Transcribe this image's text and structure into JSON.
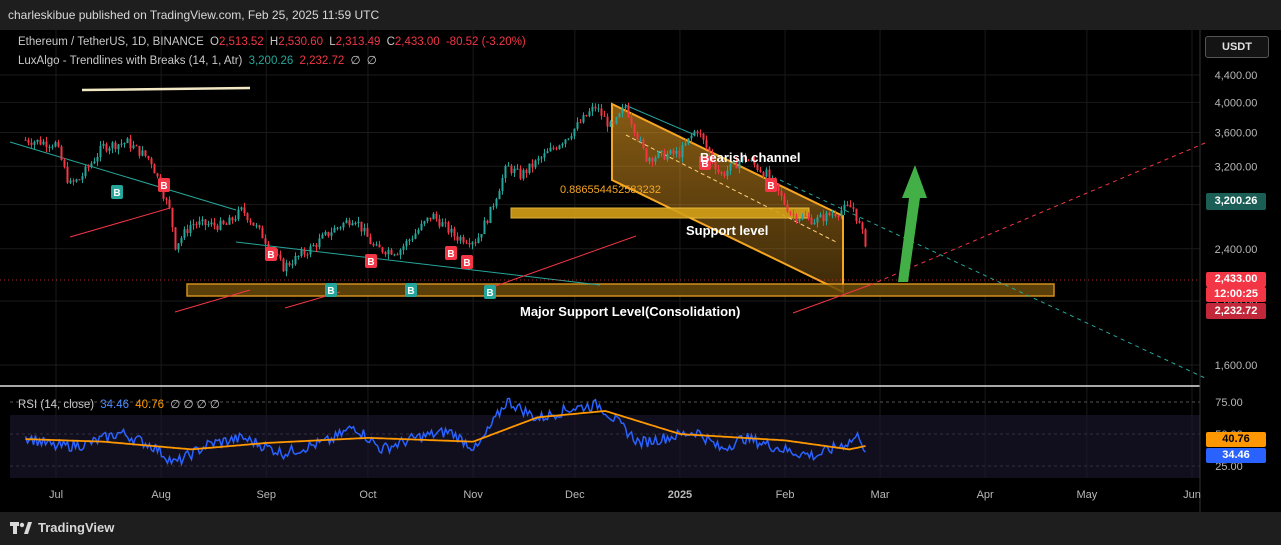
{
  "header": {
    "published": "charleskibue published on TradingView.com, Feb 25, 2025 11:59 UTC"
  },
  "legend1": {
    "symbol": "Ethereum / TetherUS, 1D, BINANCE",
    "o_label": "O",
    "o": "2,513.52",
    "h_label": "H",
    "h": "2,530.60",
    "l_label": "L",
    "l": "2,313.49",
    "c_label": "C",
    "c": "2,433.00",
    "chg": "-80.52 (-3.20%)"
  },
  "legend2": {
    "name": "LuxAlgo - Trendlines with Breaks (14, 1, Atr)",
    "v1": "3,200.26",
    "v2": "2,232.72",
    "e1": "∅",
    "e2": "∅"
  },
  "currency_button": "USDT",
  "rsi_legend": {
    "name": "RSI (14, close)",
    "v1": "34.46",
    "v2": "40.76",
    "e": "∅ ∅ ∅ ∅"
  },
  "price_tags": {
    "upper": "3,200.26",
    "last": "2,433.00",
    "countdown": "12:00:25",
    "lower": "2,232.72",
    "rsi_ma": "40.76",
    "rsi": "34.46"
  },
  "annotations": {
    "bearish": "Bearish channel",
    "support": "Support level",
    "major": "Major Support Level(Consolidation)",
    "fib": "0.886554452583232",
    "b": "B"
  },
  "footer": {
    "brand": "TradingView"
  },
  "colors": {
    "up": "#26a69a",
    "down": "#f23645",
    "channel": "#f5a623",
    "rsi": "#2962ff",
    "rsi_ma": "#ff9800",
    "arrow": "#4caf50"
  },
  "chart_data": [
    {
      "type": "candlestick",
      "x_axis": {
        "ticks": [
          "Jul",
          "Aug",
          "Sep",
          "Oct",
          "Nov",
          "Dec",
          "2025",
          "Feb",
          "Mar",
          "Apr",
          "May",
          "Jun"
        ]
      },
      "y_axis": {
        "scale": "log",
        "ticks": [
          1600,
          2000,
          2400,
          2800,
          3200,
          3600,
          4000,
          4400
        ],
        "tick_labels": [
          "1,600.00",
          "2,000.00",
          "2,400.00",
          "2,800.00",
          "3,200.00",
          "3,600.00",
          "4,000.00",
          "4,400.00"
        ],
        "range": [
          1500,
          4700
        ]
      },
      "series": [
        {
          "key": "close",
          "points": [
            [
              "2024-06-22",
              3510
            ],
            [
              "2024-07-01",
              3460
            ],
            [
              "2024-07-05",
              3000
            ],
            [
              "2024-07-08",
              3060
            ],
            [
              "2024-07-15",
              3430
            ],
            [
              "2024-07-22",
              3480
            ],
            [
              "2024-07-29",
              3270
            ],
            [
              "2024-08-04",
              2700
            ],
            [
              "2024-08-05",
              2420
            ],
            [
              "2024-08-10",
              2620
            ],
            [
              "2024-08-20",
              2600
            ],
            [
              "2024-08-25",
              2750
            ],
            [
              "2024-08-31",
              2510
            ],
            [
              "2024-09-06",
              2250
            ],
            [
              "2024-09-14",
              2400
            ],
            [
              "2024-09-20",
              2550
            ],
            [
              "2024-09-27",
              2680
            ],
            [
              "2024-10-03",
              2400
            ],
            [
              "2024-10-10",
              2380
            ],
            [
              "2024-10-20",
              2700
            ],
            [
              "2024-10-27",
              2500
            ],
            [
              "2024-11-02",
              2470
            ],
            [
              "2024-11-06",
              2720
            ],
            [
              "2024-11-11",
              3200
            ],
            [
              "2024-11-15",
              3100
            ],
            [
              "2024-11-22",
              3320
            ],
            [
              "2024-11-29",
              3560
            ],
            [
              "2024-12-07",
              3940
            ],
            [
              "2024-12-12",
              3650
            ],
            [
              "2024-12-16",
              3950
            ],
            [
              "2024-12-22",
              3300
            ],
            [
              "2025-01-01",
              3350
            ],
            [
              "2025-01-06",
              3650
            ],
            [
              "2025-01-13",
              3100
            ],
            [
              "2025-01-20",
              3300
            ],
            [
              "2025-01-27",
              3100
            ],
            [
              "2025-02-03",
              2700
            ],
            [
              "2025-02-10",
              2650
            ],
            [
              "2025-02-17",
              2740
            ],
            [
              "2025-02-21",
              2780
            ],
            [
              "2025-02-24",
              2513
            ],
            [
              "2025-02-25",
              2433
            ]
          ]
        },
        {
          "key": "trendline_upper",
          "points": [
            [
              "2025-02-25",
              3200.26
            ]
          ]
        },
        {
          "key": "trendline_lower",
          "points": [
            [
              "2025-02-25",
              2232.72
            ]
          ]
        },
        {
          "key": "support_zone",
          "points": [
            [
              "2024-08-08",
              2330
            ],
            [
              "2025-04-23",
              2200
            ]
          ]
        },
        {
          "key": "channel_support_zone",
          "points": [
            [
              "2024-11-10",
              3080
            ],
            [
              "2025-02-01",
              2990
            ]
          ]
        }
      ]
    },
    {
      "type": "line",
      "name": "RSI (14, close)",
      "y_axis": {
        "ticks": [
          25,
          50,
          75
        ],
        "tick_labels": [
          "25.00",
          "50.00",
          "75.00"
        ],
        "range": [
          20,
          80
        ]
      },
      "series": [
        {
          "key": "rsi",
          "points": [
            [
              "2024-06-22",
              48
            ],
            [
              "2024-07-01",
              40
            ],
            [
              "2024-07-10",
              42
            ],
            [
              "2024-07-20",
              51
            ],
            [
              "2024-07-30",
              40
            ],
            [
              "2024-08-05",
              27
            ],
            [
              "2024-08-15",
              42
            ],
            [
              "2024-08-25",
              47
            ],
            [
              "2024-09-06",
              35
            ],
            [
              "2024-09-20",
              45
            ],
            [
              "2024-09-27",
              56
            ],
            [
              "2024-10-05",
              38
            ],
            [
              "2024-10-15",
              47
            ],
            [
              "2024-10-25",
              52
            ],
            [
              "2024-11-02",
              38
            ],
            [
              "2024-11-11",
              76
            ],
            [
              "2024-11-20",
              62
            ],
            [
              "2024-11-30",
              70
            ],
            [
              "2024-12-08",
              73
            ],
            [
              "2024-12-20",
              43
            ],
            [
              "2025-01-06",
              52
            ],
            [
              "2025-01-13",
              38
            ],
            [
              "2025-01-20",
              47
            ],
            [
              "2025-02-03",
              36
            ],
            [
              "2025-02-10",
              33
            ],
            [
              "2025-02-20",
              44
            ],
            [
              "2025-02-23",
              49
            ],
            [
              "2025-02-25",
              34.46
            ]
          ]
        },
        {
          "key": "rsi_ma",
          "points": [
            [
              "2024-06-22",
              46
            ],
            [
              "2024-07-15",
              44
            ],
            [
              "2024-08-10",
              38
            ],
            [
              "2024-09-01",
              43
            ],
            [
              "2024-10-01",
              47
            ],
            [
              "2024-11-01",
              44
            ],
            [
              "2024-11-20",
              63
            ],
            [
              "2024-12-10",
              68
            ],
            [
              "2025-01-01",
              50
            ],
            [
              "2025-02-01",
              45
            ],
            [
              "2025-02-20",
              38
            ],
            [
              "2025-02-25",
              40.76
            ]
          ]
        }
      ]
    }
  ]
}
